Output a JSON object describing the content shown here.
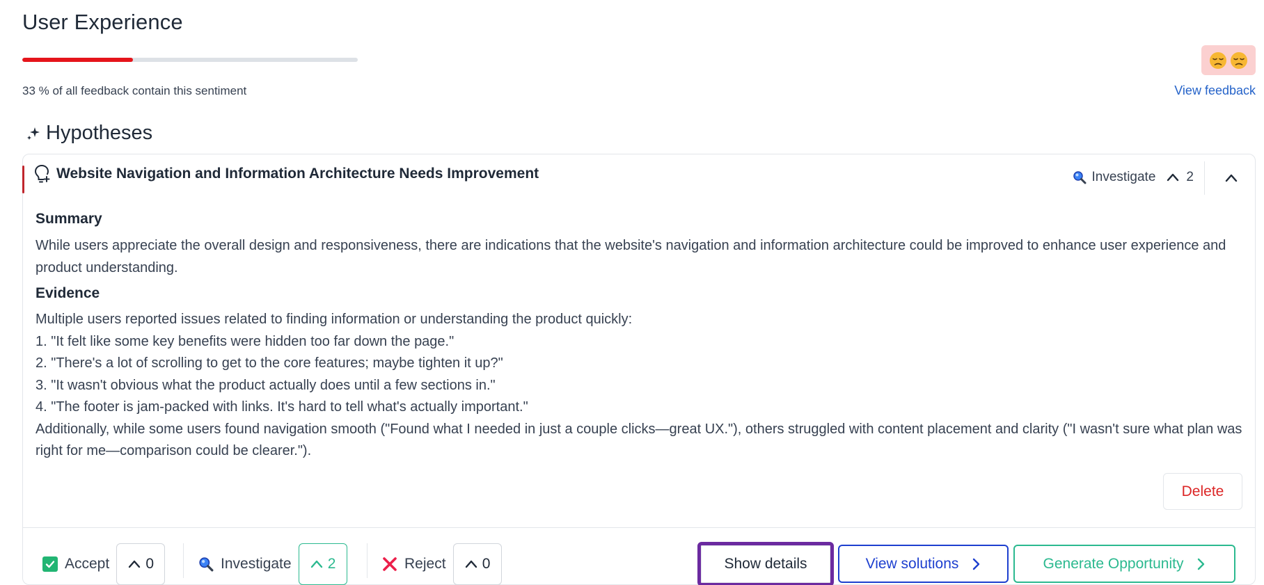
{
  "section": {
    "title": "User Experience",
    "progress_percent": 33,
    "progress_color": "#e5151b",
    "stat_text": "33 % of all feedback contain this sentiment",
    "view_feedback_label": "View feedback",
    "sentiment_icons": [
      "disappointed-face-icon",
      "disappointed-face-icon"
    ]
  },
  "hypotheses": {
    "heading": "Hypotheses",
    "card": {
      "title": "Website Navigation and Information Architecture Needs Improvement",
      "status_label": "Investigate",
      "upvotes": "2",
      "summary_label": "Summary",
      "summary_text": "While users appreciate the overall design and responsiveness, there are indications that the website's navigation and information architecture could be improved to enhance user experience and product understanding.",
      "evidence_label": "Evidence",
      "evidence_lines": [
        "Multiple users reported issues related to finding information or understanding the product quickly:",
        "1. \"It felt like some key benefits were hidden too far down the page.\"",
        "2. \"There's a lot of scrolling to get to the core features; maybe tighten it up?\"",
        "3. \"It wasn't obvious what the product actually does until a few sections in.\"",
        "4. \"The footer is jam-packed with links. It's hard to tell what's actually important.\"",
        "Additionally, while some users found navigation smooth (\"Found what I needed in just a couple clicks—great UX.\"), others struggled with content placement and clarity (\"I wasn't sure what plan was right for me—comparison could be clearer.\")."
      ],
      "delete_label": "Delete",
      "footer": {
        "accept_label": "Accept",
        "accept_count": "0",
        "investigate_label": "Investigate",
        "investigate_count": "2",
        "reject_label": "Reject",
        "reject_count": "0",
        "show_details_label": "Show details",
        "view_solutions_label": "View solutions",
        "generate_opportunity_label": "Generate Opportunity"
      }
    }
  },
  "colors": {
    "accent_red": "#e5151b",
    "link_blue": "#2563c9",
    "primary_blue": "#1d3fcf",
    "green": "#2bb98f",
    "highlight_purple": "#6b2aa0"
  }
}
